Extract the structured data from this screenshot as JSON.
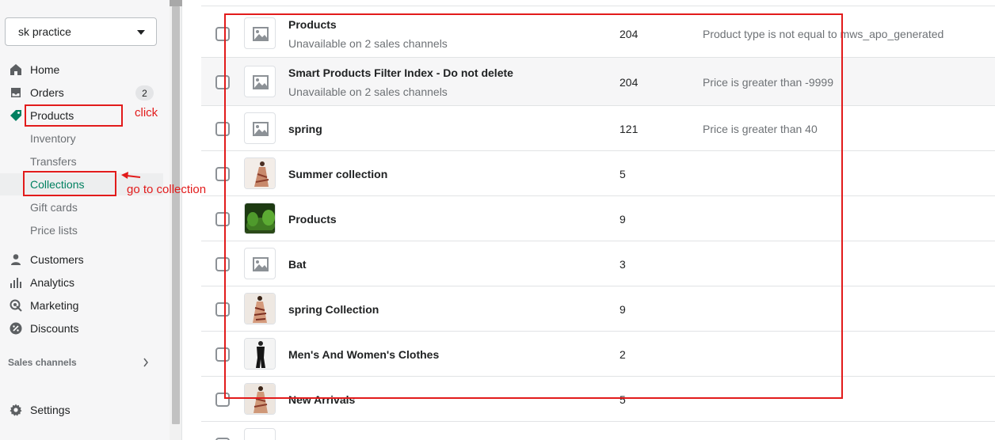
{
  "sidebar": {
    "store_name": "sk practice",
    "nav": [
      {
        "label": "Home",
        "icon": "home-icon"
      },
      {
        "label": "Orders",
        "icon": "orders-icon",
        "badge": "2"
      },
      {
        "label": "Products",
        "icon": "tag-icon"
      }
    ],
    "sub_items": [
      "Inventory",
      "Transfers",
      "Collections",
      "Gift cards",
      "Price lists"
    ],
    "nav2": [
      {
        "label": "Customers",
        "icon": "person-icon"
      },
      {
        "label": "Analytics",
        "icon": "bar-chart-icon"
      },
      {
        "label": "Marketing",
        "icon": "target-icon"
      },
      {
        "label": "Discounts",
        "icon": "discount-icon"
      }
    ],
    "sales_channels_label": "Sales channels",
    "settings_label": "Settings"
  },
  "annotations": {
    "click": "click",
    "go_to_collection": "go to collection",
    "color": "#e21b1b"
  },
  "collections": [
    {
      "title": "Products",
      "subtitle": "Unavailable on 2 sales channels",
      "count": "204",
      "condition": "Product type is not equal to mws_apo_generated",
      "thumb": "placeholder"
    },
    {
      "title": "Smart Products Filter Index - Do not delete",
      "subtitle": "Unavailable on 2 sales channels",
      "count": "204",
      "condition": "Price is greater than -9999",
      "thumb": "placeholder"
    },
    {
      "title": "spring",
      "count": "121",
      "condition": "Price is greater than 40",
      "thumb": "placeholder"
    },
    {
      "title": "Summer collection",
      "count": "5",
      "thumb": "dress-photo"
    },
    {
      "title": "Products",
      "count": "9",
      "thumb": "aquarium-photo"
    },
    {
      "title": "Bat",
      "count": "3",
      "thumb": "placeholder"
    },
    {
      "title": "spring Collection",
      "count": "9",
      "thumb": "dress-photo"
    },
    {
      "title": "Men's And Women's Clothes",
      "count": "2",
      "thumb": "black-outfit-photo"
    },
    {
      "title": "New Arrivals",
      "count": "5",
      "thumb": "dress-photo"
    }
  ],
  "colors": {
    "accent": "#008060",
    "annotation_red": "#e21b1b"
  }
}
